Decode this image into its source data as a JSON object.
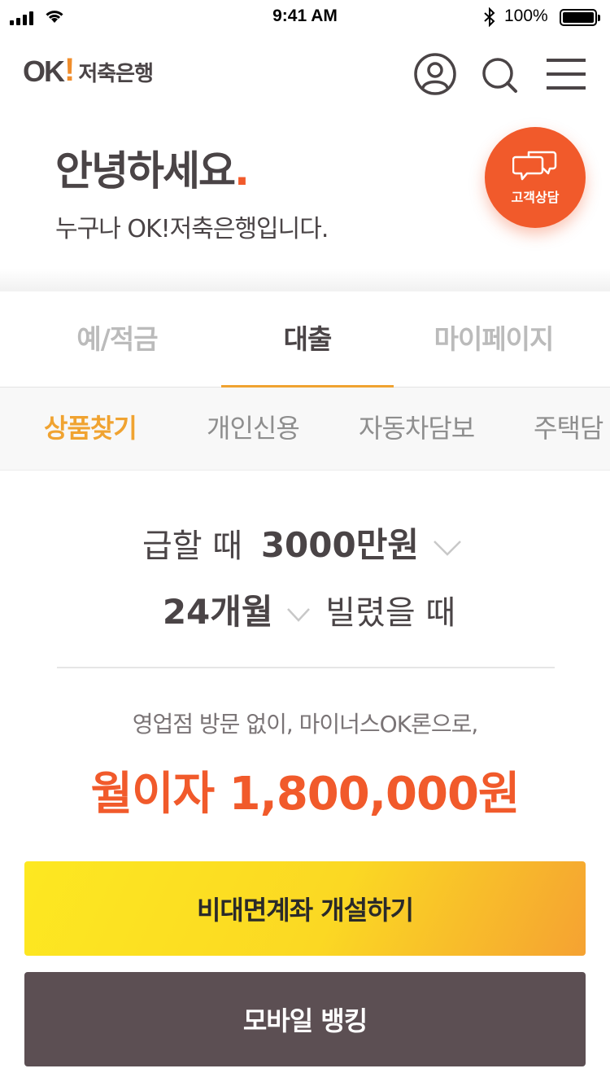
{
  "status_bar": {
    "time": "9:41 AM",
    "battery": "100%"
  },
  "header": {
    "logo_ok": "OK",
    "logo_bang": "!",
    "logo_bank": "저축은행",
    "icons": [
      "user-icon",
      "search-icon",
      "menu-icon"
    ]
  },
  "greeting": {
    "title": "안녕하세요",
    "dot": ".",
    "subtitle": "누구나 OK!저축은행입니다.",
    "consult_label": "고객상담"
  },
  "tabs": [
    {
      "label": "예/적금",
      "active": false
    },
    {
      "label": "대출",
      "active": true
    },
    {
      "label": "마이페이지",
      "active": false
    }
  ],
  "subtabs": [
    {
      "label": "상품찾기",
      "active": true
    },
    {
      "label": "개인신용",
      "active": false
    },
    {
      "label": "자동차담보",
      "active": false
    },
    {
      "label": "주택담",
      "active": false
    }
  ],
  "calculator": {
    "line1_prefix": "급할 때",
    "amount_value": "3000만원",
    "period_value": "24개월",
    "line2_suffix": "빌렸을 때",
    "promo_text": "영업점 방문 없이, 마이너스OK론으로,",
    "result_text": "월이자 1,800,000원"
  },
  "buttons": {
    "open_account": "비대면계좌 개설하기",
    "mobile_banking": "모바일 뱅킹"
  },
  "colors": {
    "accent_orange": "#f15a2b",
    "tab_underline": "#f0a331",
    "highlight_yellow": "#fbe51d",
    "dark_button": "#5c4f53"
  }
}
